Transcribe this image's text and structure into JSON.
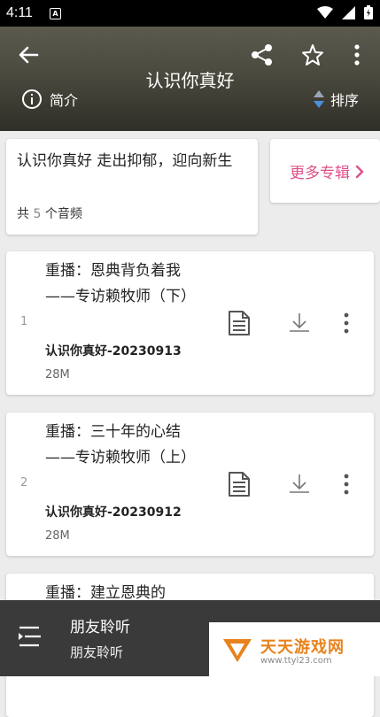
{
  "status_bar": {
    "time": "4:11",
    "notification_glyph": "A"
  },
  "header": {
    "title": "认识你真好",
    "intro_label": "简介",
    "sort_label": "排序",
    "icons": [
      "back-arrow-icon",
      "share-icon",
      "star-icon",
      "more-vert-icon",
      "info-icon",
      "sort-icon"
    ]
  },
  "album": {
    "title": "认识你真好 走出抑郁，迎向新生",
    "count_prefix": "共",
    "count": "5",
    "count_suffix": "个音频",
    "more_albums_label": "更多专辑"
  },
  "episodes": [
    {
      "index": "1",
      "title": "重播：恩典背负着我——专访赖牧师（下）",
      "album": "认识你真好-20230913",
      "size": "28M"
    },
    {
      "index": "2",
      "title": "重播：三十年的心结——专访赖牧师（上）",
      "album": "认识你真好-20230912",
      "size": "28M"
    },
    {
      "index": "",
      "title": "重播：建立恩典的",
      "album": "",
      "size": ""
    }
  ],
  "player": {
    "title": "朋友聆听",
    "subtitle": "朋友聆听"
  },
  "watermark": {
    "name": "天天游戏网",
    "url": "www.ttyl23.com"
  },
  "colors": {
    "accent": "#e0508a",
    "header_top": "#5b5a4d",
    "header_bottom": "#2f2e27",
    "player_bg": "#3a3a3a",
    "sort_icon": "#4a90d9"
  }
}
